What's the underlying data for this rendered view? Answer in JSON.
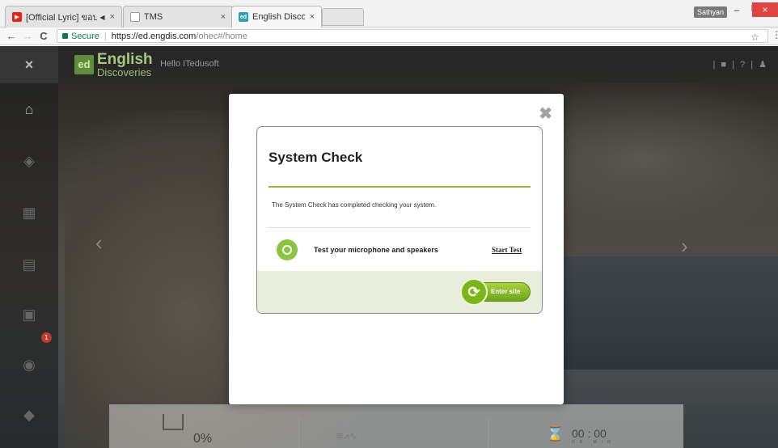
{
  "browser": {
    "tabs": [
      {
        "title": "[Official Lyric] ขอบเลื่อน",
        "audio": "◀︎",
        "close": "×"
      },
      {
        "title": "TMS",
        "close": "×"
      },
      {
        "title": "English Discoveries",
        "close": "×"
      }
    ],
    "profile": "Sathyan",
    "window_controls": {
      "minimize": "–",
      "maximize": "❐",
      "close": "×"
    },
    "nav": {
      "back": "←",
      "forward": "→",
      "reload": "C"
    },
    "address": {
      "secure_label": "Secure",
      "separator": "|",
      "url_host": "https://ed.engdis.com",
      "url_path": "/ohec#/home"
    },
    "star": "☆",
    "menu": "⋮"
  },
  "app": {
    "close_glyph": "×",
    "logo": {
      "mark": "ed",
      "word1": "English",
      "word2": "Discoveries"
    },
    "greeting": "Hello ITedusoft",
    "top_icons": "| ■ | ? | ♟",
    "sidebar_badge": "1",
    "stats": {
      "progress": "0%",
      "wave": "≋⩘∿",
      "time": "00 : 00",
      "time_units": "HR  MIN"
    }
  },
  "modal": {
    "close_glyph": "✖",
    "title": "System Check",
    "message": "The System Check has completed checking your system.",
    "mic_label": "Test your microphone and speakers",
    "start_test": "Start Test",
    "enter_label": "Enter site",
    "enter_glyph": "⟳"
  },
  "colors": {
    "accent_green": "#8bc53f",
    "rule_green": "#9ab63d",
    "footer_bg": "#e8eedb"
  }
}
